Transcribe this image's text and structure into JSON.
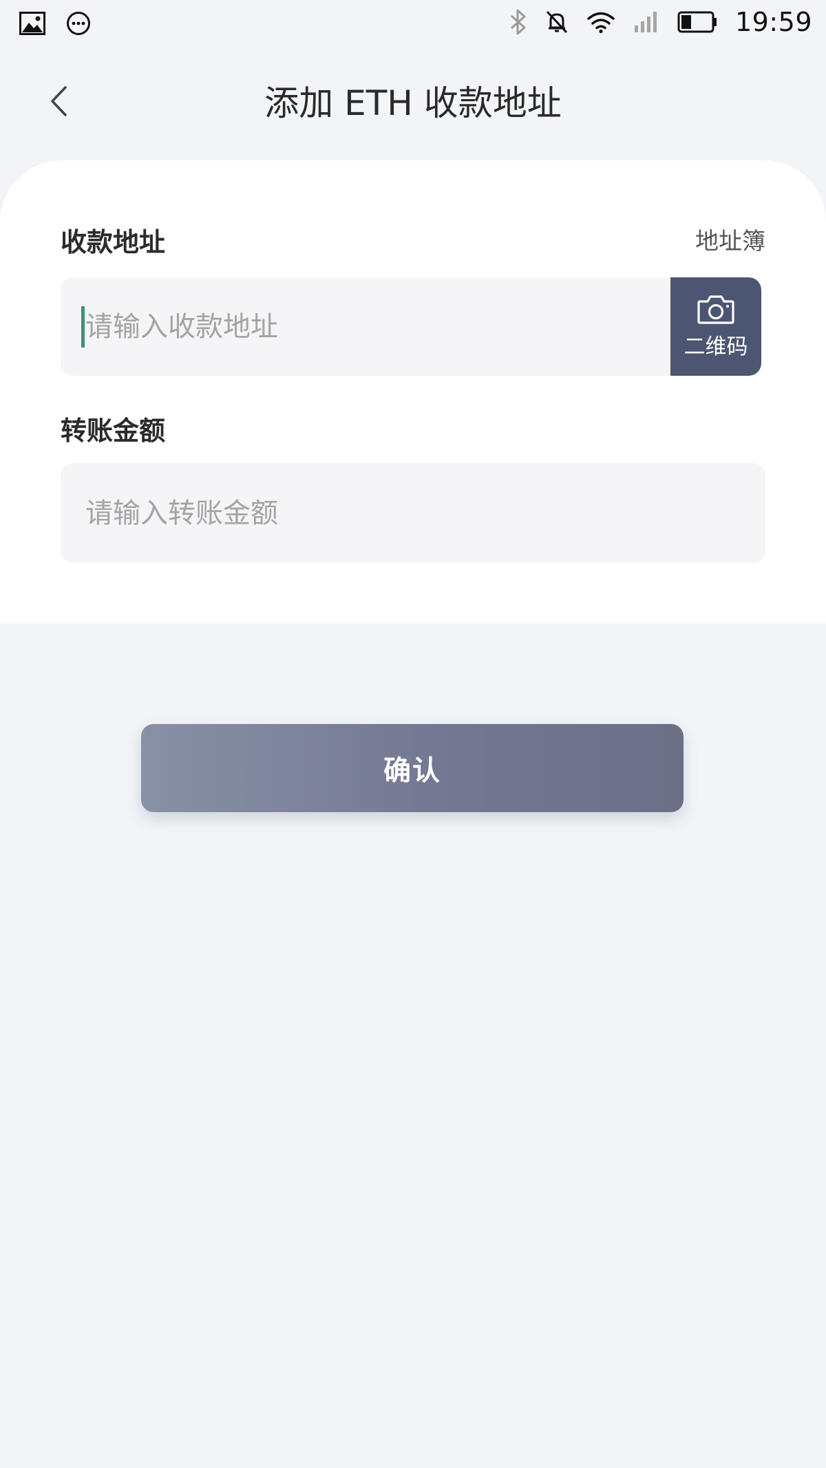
{
  "status_bar": {
    "time": "19:59",
    "left_icons": [
      "image-icon",
      "message-icon"
    ],
    "right_icons": [
      "bluetooth-icon",
      "mute-icon",
      "wifi-icon",
      "signal-icon",
      "battery-icon"
    ]
  },
  "header": {
    "title": "添加 ETH 收款地址",
    "back_icon": "chevron-left-icon"
  },
  "form": {
    "address": {
      "label": "收款地址",
      "placeholder": "请输入收款地址",
      "value": "",
      "address_book_label": "地址簿",
      "qr_button_label": "二维码",
      "qr_icon": "camera-icon"
    },
    "amount": {
      "label": "转账金额",
      "placeholder": "请输入转账金额",
      "value": ""
    }
  },
  "actions": {
    "confirm_label": "确认"
  },
  "colors": {
    "background": "#f3f4f8",
    "card": "#ffffff",
    "input_bg": "#f5f5f7",
    "qr_button": "#4c5572",
    "cursor": "#3f8f78",
    "confirm_start": "#8891a5",
    "confirm_end": "#6a7086"
  }
}
